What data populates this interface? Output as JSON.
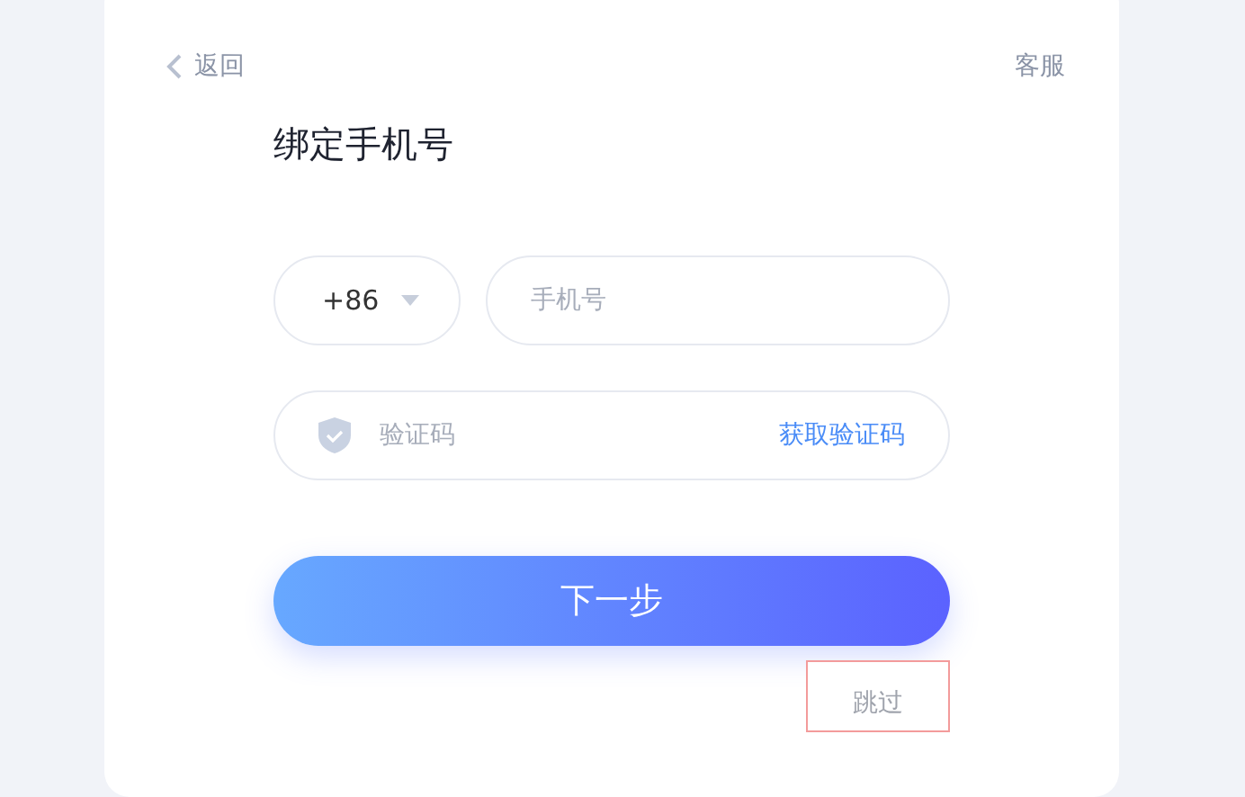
{
  "header": {
    "back": "返回",
    "service": "客服"
  },
  "title": "绑定手机号",
  "phone": {
    "country_code": "+86",
    "placeholder": "手机号"
  },
  "code": {
    "placeholder": "验证码",
    "action": "获取验证码"
  },
  "next_button": "下一步",
  "skip_button": "跳过"
}
